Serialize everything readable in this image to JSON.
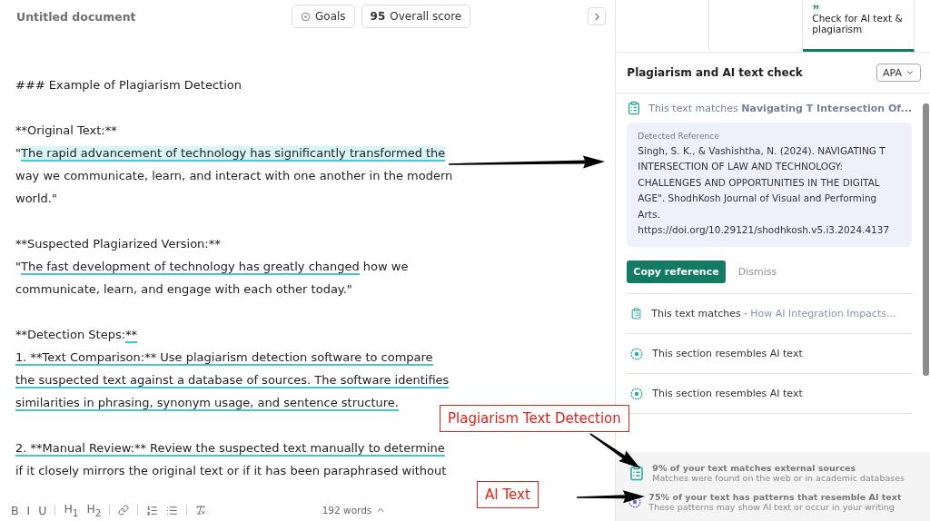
{
  "document": {
    "title": "Untitled document",
    "goals": "Goals",
    "score": "95",
    "score_label": "Overall score",
    "paragraphs": [
      {
        "lines": [
          {
            "segments": [
              {
                "text": "### Example of Plagiarism Detection",
                "kind": "plain"
              }
            ]
          }
        ]
      },
      {
        "lines": [
          {
            "segments": [
              {
                "text": "**Original Text:**",
                "kind": "plain"
              }
            ]
          },
          {
            "segments": [
              {
                "text": "\"",
                "kind": "plain"
              },
              {
                "text": "The rapid advancement of technology has significantly transformed the",
                "kind": "highlight"
              }
            ]
          },
          {
            "segments": [
              {
                "text": "way we communicate, learn, and interact with one another in the modern",
                "kind": "plain"
              }
            ]
          },
          {
            "segments": [
              {
                "text": "world.\"",
                "kind": "plain"
              }
            ]
          }
        ]
      },
      {
        "lines": [
          {
            "segments": [
              {
                "text": "**Suspected Plagiarized Version:**",
                "kind": "plain"
              }
            ]
          },
          {
            "segments": [
              {
                "text": "\"",
                "kind": "plain"
              },
              {
                "text": "The fast development of technology has greatly changed",
                "kind": "underline"
              },
              {
                "text": " how we",
                "kind": "plain"
              }
            ]
          },
          {
            "segments": [
              {
                "text": "communicate, learn, and engage with each other today.\"",
                "kind": "plain"
              }
            ]
          }
        ]
      },
      {
        "lines": [
          {
            "segments": [
              {
                "text": "**Detection Steps:",
                "kind": "plain"
              },
              {
                "text": "**",
                "kind": "underline"
              }
            ]
          },
          {
            "segments": [
              {
                "text": "1. **Text Comparison:** Use plagiarism detection software to compare",
                "kind": "underline"
              }
            ]
          },
          {
            "segments": [
              {
                "text": "the suspected text against a database of sources. The software identifies",
                "kind": "underline"
              }
            ]
          },
          {
            "segments": [
              {
                "text": "similarities in phrasing, synonym usage, and sentence structure.",
                "kind": "underline"
              }
            ]
          }
        ]
      },
      {
        "lines": [
          {
            "segments": [
              {
                "text": "2. **Manual Review:** Review the suspected text manually to determine",
                "kind": "underline"
              }
            ]
          },
          {
            "segments": [
              {
                "text": "if it closely mirrors the original text or if it has been paraphrased without",
                "kind": "plain"
              }
            ]
          }
        ]
      }
    ],
    "toolbar": [
      {
        "kind": "text",
        "label": "B"
      },
      {
        "kind": "text",
        "label": "I"
      },
      {
        "kind": "text",
        "label": "U"
      },
      {
        "kind": "divider"
      },
      {
        "kind": "text",
        "label": "H$_{1}$"
      },
      {
        "kind": "text",
        "label": "H$_{2}$"
      },
      {
        "kind": "divider"
      },
      {
        "kind": "link"
      },
      {
        "kind": "divider"
      },
      {
        "kind": "ordered-list"
      },
      {
        "kind": "bullet-list"
      },
      {
        "kind": "divider"
      },
      {
        "kind": "clear-format"
      }
    ],
    "word_count": "192 words"
  },
  "panel": {
    "tabs": [
      {
        "selected": false
      },
      {
        "selected": false
      },
      {
        "label": "Check for AI text & plagiarism",
        "selected": true
      }
    ],
    "title": "Plagiarism and AI text check",
    "style": "APA",
    "match": {
      "text": "This text matches **Navigating T Intersection Of...**",
      "reference_label": "Detected Reference",
      "reference": "Singh, S. K., & Vashishtha, N. (2024). NAVIGATING T INTERSECTION OF LAW AND TECHNOLOGY: CHALLENGES AND OPPORTUNITIES IN THE DIGITAL AGE\". ShodhKosh Journal of Visual and Performing Arts. https://doi.org/10.29121/shodhkosh.v5.i3.2024.4137",
      "copy": "Copy reference",
      "dismiss": "Dismiss"
    },
    "items": [
      {
        "kind": "match",
        "text": "This text matches · ",
        "source": "How AI Integration Impacts..."
      },
      {
        "kind": "ai",
        "text": "This section resembles AI text"
      },
      {
        "kind": "ai",
        "text": "This section resembles AI text"
      }
    ],
    "summary": [
      {
        "kind": "match",
        "title": "9% of your text matches external sources",
        "detail": "Matches were found on the web or in academic databases"
      },
      {
        "kind": "ai",
        "title": "75% of your text has patterns that resemble AI text",
        "detail": "These patterns may show AI text or occur in your writing"
      }
    ]
  },
  "annotations": [
    {
      "label": "Plagiarism Text Detection"
    },
    {
      "label": "AI Text"
    }
  ]
}
